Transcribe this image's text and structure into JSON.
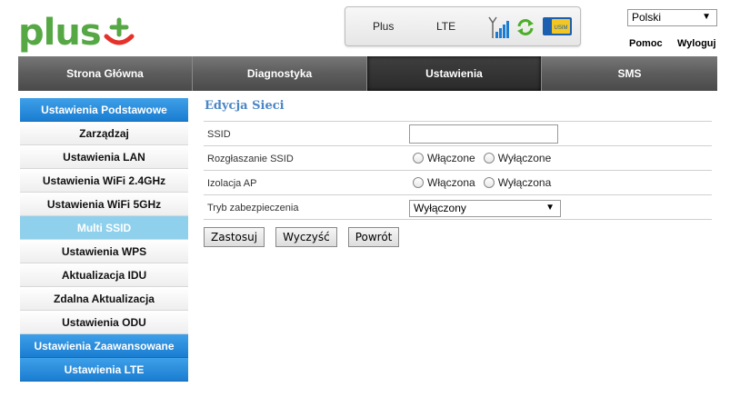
{
  "logo": {
    "text": "plus"
  },
  "status": {
    "operator": "Plus",
    "network": "LTE",
    "sim_label": "USIM",
    "signal_icon": "signal-icon",
    "refresh_icon": "refresh-icon"
  },
  "language": {
    "selected": "Polski"
  },
  "links": {
    "help": "Pomoc",
    "logout": "Wyloguj"
  },
  "nav": {
    "tabs": [
      {
        "label": "Strona Główna"
      },
      {
        "label": "Diagnostyka"
      },
      {
        "label": "Ustawienia",
        "active": true
      },
      {
        "label": "SMS"
      }
    ]
  },
  "sidebar": {
    "items": [
      {
        "label": "Ustawienia Podstawowe",
        "kind": "header"
      },
      {
        "label": "Zarządzaj"
      },
      {
        "label": "Ustawienia LAN"
      },
      {
        "label": "Ustawienia WiFi 2.4GHz"
      },
      {
        "label": "Ustawienia WiFi 5GHz"
      },
      {
        "label": "Multi SSID",
        "kind": "selected"
      },
      {
        "label": "Ustawienia WPS"
      },
      {
        "label": "Aktualizacja IDU"
      },
      {
        "label": "Zdalna Aktualizacja"
      },
      {
        "label": "Ustawienia ODU"
      },
      {
        "label": "Ustawienia Zaawansowane",
        "kind": "header"
      },
      {
        "label": "Ustawienia LTE",
        "kind": "header"
      }
    ]
  },
  "form": {
    "title": "Edycja Sieci",
    "ssid": {
      "label": "SSID",
      "value": ""
    },
    "broadcast": {
      "label": "Rozgłaszanie SSID",
      "on": "Włączone",
      "off": "Wyłączone"
    },
    "isolation": {
      "label": "Izolacja AP",
      "on": "Włączona",
      "off": "Wyłączona"
    },
    "security": {
      "label": "Tryb zabezpieczenia",
      "selected": "Wyłączony"
    },
    "buttons": {
      "apply": "Zastosuj",
      "clear": "Wyczyść",
      "back": "Powrót"
    }
  },
  "colors": {
    "brand_green": "#56a845",
    "brand_red": "#e4322b",
    "sidebar_header": "#1b7dd1",
    "sidebar_selected": "#8fd0ec",
    "title_blue": "#4b86c6"
  }
}
